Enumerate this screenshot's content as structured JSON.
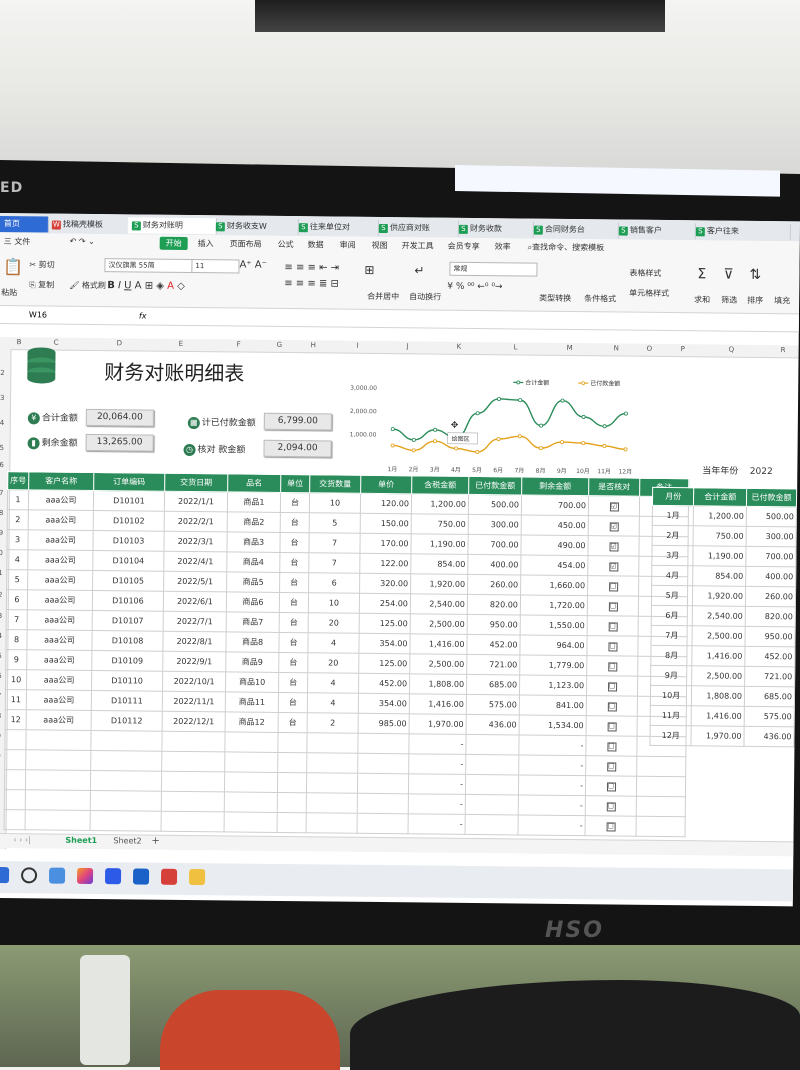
{
  "monitor": {
    "brand": "ED",
    "bottom_logo": "HSO"
  },
  "tabs": [
    {
      "label": "首页",
      "type": "home"
    },
    {
      "label": "找稿壳模板",
      "type": "doc"
    },
    {
      "label": "财务对账明",
      "type": "sheet",
      "active": true
    },
    {
      "label": "财务收支W",
      "type": "sheet"
    },
    {
      "label": "往来单位对",
      "type": "sheet"
    },
    {
      "label": "供应商对账",
      "type": "sheet"
    },
    {
      "label": "财务收款",
      "type": "sheet"
    },
    {
      "label": "合同财务台",
      "type": "sheet"
    },
    {
      "label": "销售客户",
      "type": "sheet"
    },
    {
      "label": "客户往来",
      "type": "sheet"
    }
  ],
  "menu": {
    "file": "三 文件",
    "start": "开始",
    "items": [
      "插入",
      "页面布局",
      "公式",
      "数据",
      "审阅",
      "视图",
      "开发工具",
      "会员专享",
      "效率"
    ],
    "search": "查找命令、搜索模板"
  },
  "ribbon": {
    "paste": "粘贴",
    "cut": "剪切",
    "copy": "复制",
    "format_painter": "格式刷",
    "font_name": "汉仪旗黑 55简",
    "font_size": "11",
    "merge_center": "合并居中",
    "wrap": "自动换行",
    "number_format": "常规",
    "type_convert": "类型转换",
    "cond_format": "条件格式",
    "table_style": "表格样式",
    "cell_style": "单元格样式",
    "sum": "求和",
    "filter": "筛选",
    "sort": "排序",
    "fill": "填充"
  },
  "formula_bar": {
    "cell_ref": "W16",
    "fx": "fx"
  },
  "columns": [
    "B",
    "C",
    "D",
    "E",
    "F",
    "G",
    "H",
    "I",
    "J",
    "K",
    "L",
    "M",
    "N",
    "O",
    "P",
    "Q",
    "R"
  ],
  "row_numbers": [
    "2",
    "3",
    "4",
    "5",
    "6",
    "7",
    "8",
    "9",
    "0",
    "1",
    "2",
    "3",
    "4",
    "5",
    "6",
    "7",
    "8",
    "9",
    "0",
    "1",
    "2",
    "3",
    "4",
    "5",
    "6"
  ],
  "sheet_title": "财务对账明细表",
  "summary": {
    "total_label": "合计金额",
    "total_value": "20,064.00",
    "paid_label": "计已付款金额",
    "paid_value": "6,799.00",
    "remain_label": "剩余金额",
    "remain_value": "13,265.00",
    "checked_label": "核对",
    "checked_sub": "款金额",
    "checked_value": "2,094.00"
  },
  "chart_data": {
    "type": "line",
    "categories": [
      "1月",
      "2月",
      "3月",
      "4月",
      "5月",
      "6月",
      "7月",
      "8月",
      "9月",
      "10月",
      "11月",
      "12月"
    ],
    "series": [
      {
        "name": "合计金额",
        "values": [
          1200,
          750,
          1190,
          854,
          1920,
          2540,
          2500,
          1416,
          2500,
          1808,
          1416,
          1970
        ]
      },
      {
        "name": "已付款金额",
        "values": [
          500,
          300,
          700,
          400,
          260,
          820,
          950,
          452,
          721,
          685,
          575,
          436
        ]
      }
    ],
    "ytick_labels": [
      "3,000.00",
      "2,000.00",
      "1,000.00"
    ],
    "ylim": [
      0,
      3000
    ],
    "legend_position": "top-right",
    "colors": [
      "#2a8c5a",
      "#e3a21a"
    ],
    "annotation": "绘图区"
  },
  "table": {
    "headers": [
      "序号",
      "客户名称",
      "订单编码",
      "交货日期",
      "品名",
      "单位",
      "交货数量",
      "单价",
      "含税金额",
      "已付款金额",
      "剩余金额",
      "是否核对",
      "备注"
    ],
    "rows": [
      [
        "1",
        "aaa公司",
        "D10101",
        "2022/1/1",
        "商品1",
        "台",
        "10",
        "120.00",
        "1,200.00",
        "500.00",
        "700.00",
        "☑",
        ""
      ],
      [
        "2",
        "aaa公司",
        "D10102",
        "2022/2/1",
        "商品2",
        "台",
        "5",
        "150.00",
        "750.00",
        "300.00",
        "450.00",
        "☑",
        ""
      ],
      [
        "3",
        "aaa公司",
        "D10103",
        "2022/3/1",
        "商品3",
        "台",
        "7",
        "170.00",
        "1,190.00",
        "700.00",
        "490.00",
        "☑",
        ""
      ],
      [
        "4",
        "aaa公司",
        "D10104",
        "2022/4/1",
        "商品4",
        "台",
        "7",
        "122.00",
        "854.00",
        "400.00",
        "454.00",
        "☑",
        ""
      ],
      [
        "5",
        "aaa公司",
        "D10105",
        "2022/5/1",
        "商品5",
        "台",
        "6",
        "320.00",
        "1,920.00",
        "260.00",
        "1,660.00",
        "☐",
        ""
      ],
      [
        "6",
        "aaa公司",
        "D10106",
        "2022/6/1",
        "商品6",
        "台",
        "10",
        "254.00",
        "2,540.00",
        "820.00",
        "1,720.00",
        "☐",
        ""
      ],
      [
        "7",
        "aaa公司",
        "D10107",
        "2022/7/1",
        "商品7",
        "台",
        "20",
        "125.00",
        "2,500.00",
        "950.00",
        "1,550.00",
        "☐",
        ""
      ],
      [
        "8",
        "aaa公司",
        "D10108",
        "2022/8/1",
        "商品8",
        "台",
        "4",
        "354.00",
        "1,416.00",
        "452.00",
        "964.00",
        "☐",
        ""
      ],
      [
        "9",
        "aaa公司",
        "D10109",
        "2022/9/1",
        "商品9",
        "台",
        "20",
        "125.00",
        "2,500.00",
        "721.00",
        "1,779.00",
        "☐",
        ""
      ],
      [
        "10",
        "aaa公司",
        "D10110",
        "2022/10/1",
        "商品10",
        "台",
        "4",
        "452.00",
        "1,808.00",
        "685.00",
        "1,123.00",
        "☐",
        ""
      ],
      [
        "11",
        "aaa公司",
        "D10111",
        "2022/11/1",
        "商品11",
        "台",
        "4",
        "354.00",
        "1,416.00",
        "575.00",
        "841.00",
        "☐",
        ""
      ],
      [
        "12",
        "aaa公司",
        "D10112",
        "2022/12/1",
        "商品12",
        "台",
        "2",
        "985.00",
        "1,970.00",
        "436.00",
        "1,534.00",
        "☐",
        ""
      ],
      [
        "",
        "",
        "",
        "",
        "",
        "",
        "",
        "",
        "-",
        "",
        "-",
        "☐",
        ""
      ],
      [
        "",
        "",
        "",
        "",
        "",
        "",
        "",
        "",
        "-",
        "",
        "-",
        "☐",
        ""
      ],
      [
        "",
        "",
        "",
        "",
        "",
        "",
        "",
        "",
        "-",
        "",
        "-",
        "☐",
        ""
      ],
      [
        "",
        "",
        "",
        "",
        "",
        "",
        "",
        "",
        "-",
        "",
        "-",
        "☐",
        ""
      ],
      [
        "",
        "",
        "",
        "",
        "",
        "",
        "",
        "",
        "-",
        "",
        "-",
        "☐",
        ""
      ]
    ]
  },
  "year": {
    "label": "当年年份",
    "value": "2022"
  },
  "monthly": {
    "headers": [
      "月份",
      "合计金额",
      "已付款金额"
    ],
    "rows": [
      [
        "1月",
        "1,200.00",
        "500.00"
      ],
      [
        "2月",
        "750.00",
        "300.00"
      ],
      [
        "3月",
        "1,190.00",
        "700.00"
      ],
      [
        "4月",
        "854.00",
        "400.00"
      ],
      [
        "5月",
        "1,920.00",
        "260.00"
      ],
      [
        "6月",
        "2,540.00",
        "820.00"
      ],
      [
        "7月",
        "2,500.00",
        "950.00"
      ],
      [
        "8月",
        "1,416.00",
        "452.00"
      ],
      [
        "9月",
        "2,500.00",
        "721.00"
      ],
      [
        "10月",
        "1,808.00",
        "685.00"
      ],
      [
        "11月",
        "1,416.00",
        "575.00"
      ],
      [
        "12月",
        "1,970.00",
        "436.00"
      ]
    ]
  },
  "sheets": [
    "Sheet1",
    "Sheet2"
  ],
  "add_sheet": "+"
}
